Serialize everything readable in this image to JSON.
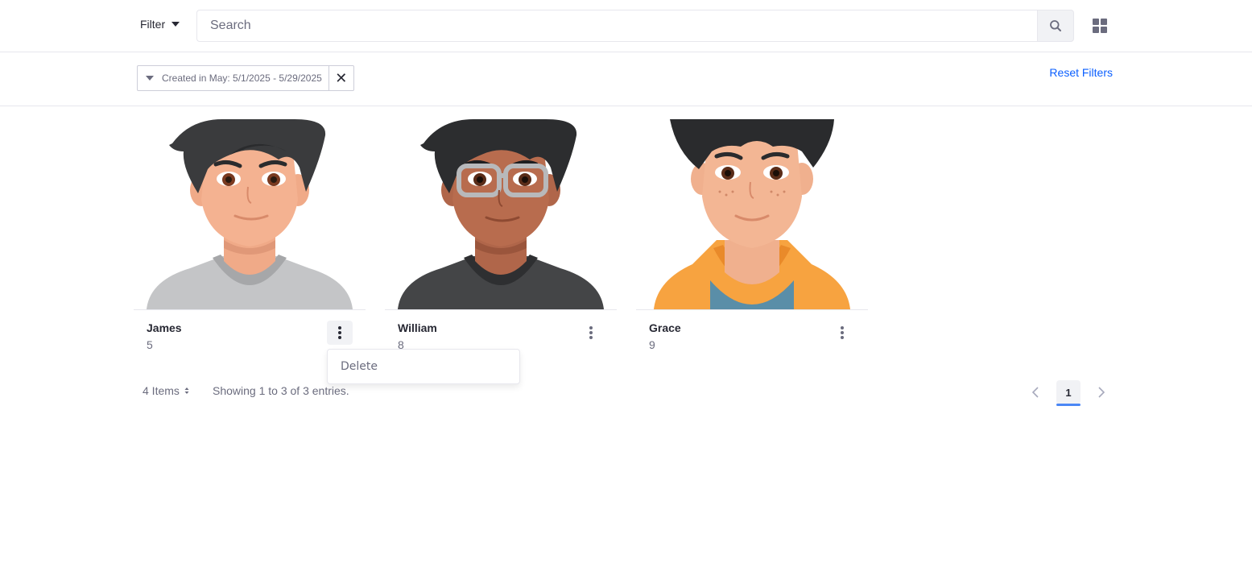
{
  "toolbar": {
    "filter_label": "Filter",
    "search_placeholder": "Search",
    "search_value": ""
  },
  "filter_bar": {
    "active_filter": "Created in May: 5/1/2025 - 5/29/2025",
    "reset_label": "Reset Filters"
  },
  "cards": [
    {
      "name": "James",
      "count": "5",
      "avatar": "boy-avatar-gray-shirt"
    },
    {
      "name": "William",
      "count": "8",
      "avatar": "boy-avatar-glasses-dark-shirt"
    },
    {
      "name": "Grace",
      "count": "9",
      "avatar": "avatar-orange-hoodie"
    }
  ],
  "dropdown": {
    "items": [
      "Delete"
    ]
  },
  "footer": {
    "items_per_page": "4 Items",
    "showing_text": "Showing 1 to 3 of 3 entries.",
    "current_page": "1"
  },
  "colors": {
    "accent": "#0b5fff",
    "page_indicator": "#4b87f5"
  }
}
